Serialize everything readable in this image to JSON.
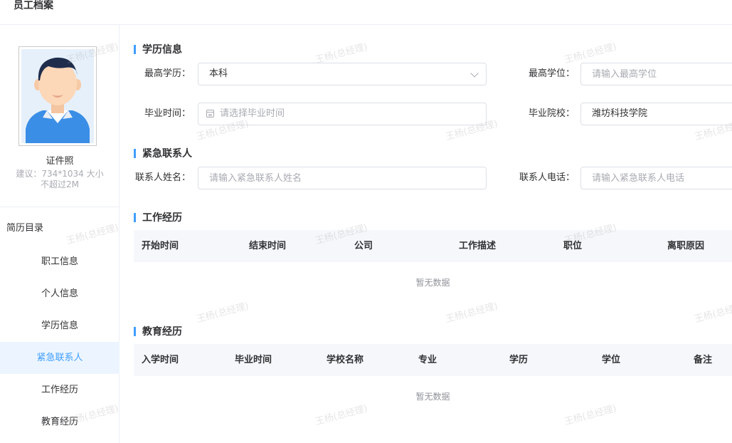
{
  "header": {
    "title": "员工档案"
  },
  "sidebar": {
    "photo_label": "证件照",
    "photo_hint_1": "建议：734*1034 大小",
    "photo_hint_2": "不超过2M",
    "toc_title": "简历目录",
    "items": [
      {
        "label": "职工信息"
      },
      {
        "label": "个人信息"
      },
      {
        "label": "学历信息"
      },
      {
        "label": "紧急联系人"
      },
      {
        "label": "工作经历"
      },
      {
        "label": "教育经历"
      }
    ]
  },
  "education": {
    "title": "学历信息",
    "highest_edu_label": "最高学历：",
    "highest_edu_value": "本科",
    "highest_degree_label": "最高学位：",
    "highest_degree_placeholder": "请输入最高学位",
    "grad_time_label": "毕业时间：",
    "grad_time_placeholder": "请选择毕业时间",
    "school_label": "毕业院校：",
    "school_value": "潍坊科技学院"
  },
  "emergency": {
    "title": "紧急联系人",
    "name_label": "联系人姓名：",
    "name_placeholder": "请输入紧急联系人姓名",
    "phone_label": "联系人电话：",
    "phone_placeholder": "请输入紧急联系人电话"
  },
  "work": {
    "title": "工作经历",
    "columns": [
      "开始时间",
      "结束时间",
      "公司",
      "工作描述",
      "职位",
      "离职原因"
    ],
    "empty": "暂无数据"
  },
  "edu_history": {
    "title": "教育经历",
    "columns": [
      "入学时间",
      "毕业时间",
      "学校名称",
      "专业",
      "学历",
      "学位",
      "备注"
    ],
    "empty": "暂无数据"
  },
  "watermark": "王杨(总经理)"
}
